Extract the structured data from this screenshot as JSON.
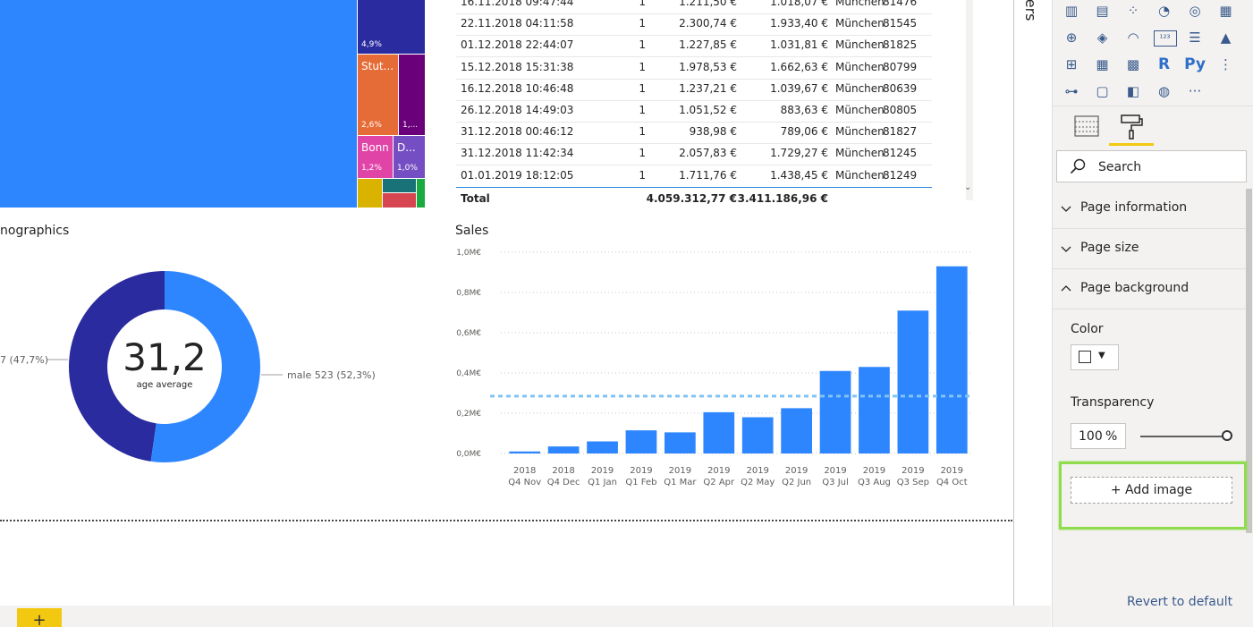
{
  "treemap": {
    "tiles": [
      {
        "label": "",
        "pct": "",
        "color": "#2E86FF"
      },
      {
        "label": "",
        "pct": "4,9%",
        "color": "#2A2B9E"
      },
      {
        "label": "Stut...",
        "pct": "2,6%",
        "color": "#E66C37"
      },
      {
        "label": "",
        "pct": "1,...",
        "color": "#6B007B"
      },
      {
        "label": "Bonn",
        "pct": "1,2%",
        "color": "#E044A7"
      },
      {
        "label": "D...",
        "pct": "1,0%",
        "color": "#744EC2"
      },
      {
        "label": "",
        "pct": "",
        "color": "#D9B300"
      },
      {
        "label": "",
        "pct": "",
        "color": "#197278"
      },
      {
        "label": "",
        "pct": "",
        "color": "#D64550"
      },
      {
        "label": "",
        "pct": "",
        "color": "#1AAB40"
      }
    ]
  },
  "table": {
    "rows": [
      {
        "date": "16.11.2018 09:47:44",
        "qty": "1",
        "gross": "1.211,50 €",
        "net": "1.018,07 €",
        "city": "München",
        "zip": "81476"
      },
      {
        "date": "22.11.2018 04:11:58",
        "qty": "1",
        "gross": "2.300,74 €",
        "net": "1.933,40 €",
        "city": "München",
        "zip": "81545"
      },
      {
        "date": "01.12.2018 22:44:07",
        "qty": "1",
        "gross": "1.227,85 €",
        "net": "1.031,81 €",
        "city": "München",
        "zip": "81825"
      },
      {
        "date": "15.12.2018 15:31:38",
        "qty": "1",
        "gross": "1.978,53 €",
        "net": "1.662,63 €",
        "city": "München",
        "zip": "80799"
      },
      {
        "date": "16.12.2018 10:46:48",
        "qty": "1",
        "gross": "1.237,21 €",
        "net": "1.039,67 €",
        "city": "München",
        "zip": "80639"
      },
      {
        "date": "26.12.2018 14:49:03",
        "qty": "1",
        "gross": "1.051,52 €",
        "net": "883,63 €",
        "city": "München",
        "zip": "80805"
      },
      {
        "date": "31.12.2018 00:46:12",
        "qty": "1",
        "gross": "938,98 €",
        "net": "789,06 €",
        "city": "München",
        "zip": "81827"
      },
      {
        "date": "31.12.2018 11:42:34",
        "qty": "1",
        "gross": "2.057,83 €",
        "net": "1.729,27 €",
        "city": "München",
        "zip": "81245"
      },
      {
        "date": "01.01.2019 18:12:05",
        "qty": "1",
        "gross": "1.711,76 €",
        "net": "1.438,45 €",
        "city": "München",
        "zip": "81249"
      }
    ],
    "total_label": "Total",
    "total_gross": "4.059.312,77 €",
    "total_net": "3.411.186,96 €"
  },
  "demographics": {
    "title": "nographics",
    "center_value": "31,2",
    "center_label": "age average",
    "left_label": "7 (47,7%)",
    "right_label": "male 523 (52,3%)",
    "slices": [
      {
        "value": 47.7,
        "color": "#2A2B9E"
      },
      {
        "value": 52.3,
        "color": "#2E86FF"
      }
    ]
  },
  "chart_data": {
    "type": "bar",
    "title": "Sales",
    "categories": [
      "2018 Q4 Nov",
      "2018 Q4 Dec",
      "2019 Q1 Jan",
      "2019 Q1 Feb",
      "2019 Q1 Mar",
      "2019 Q2 Apr",
      "2019 Q2 May",
      "2019 Q2 Jun",
      "2019 Q3 Jul",
      "2019 Q3 Aug",
      "2019 Q3 Sep",
      "2019 Q4 Oct"
    ],
    "category_lines": [
      [
        "2018",
        "Q4 Nov"
      ],
      [
        "2018",
        "Q4 Dec"
      ],
      [
        "2019",
        "Q1 Jan"
      ],
      [
        "2019",
        "Q1 Feb"
      ],
      [
        "2019",
        "Q1 Mar"
      ],
      [
        "2019",
        "Q2 Apr"
      ],
      [
        "2019",
        "Q2 May"
      ],
      [
        "2019",
        "Q2 Jun"
      ],
      [
        "2019",
        "Q3 Jul"
      ],
      [
        "2019",
        "Q3 Aug"
      ],
      [
        "2019",
        "Q3 Sep"
      ],
      [
        "2019",
        "Q4 Oct"
      ]
    ],
    "values": [
      0.01,
      0.035,
      0.06,
      0.115,
      0.105,
      0.205,
      0.18,
      0.225,
      0.41,
      0.43,
      0.71,
      0.93
    ],
    "average_line": 0.285,
    "ylim": [
      0,
      1.0
    ],
    "yticks": [
      0,
      0.2,
      0.4,
      0.6,
      0.8,
      1.0
    ],
    "ytick_labels": [
      "0,0M€",
      "0,2M€",
      "0,4M€",
      "0,6M€",
      "0,8M€",
      "1,0M€"
    ],
    "bar_color": "#2E86FF",
    "average_color": "#7FC4F2",
    "xlabel": "",
    "ylabel": ""
  },
  "filters": {
    "label": "lters"
  },
  "viz_pane": {
    "icons": [
      [
        "stacked-bar-icon",
        "▥"
      ],
      [
        "clustered-column-icon",
        "▤"
      ],
      [
        "scatter-icon",
        "⁘"
      ],
      [
        "pie-icon",
        "◔"
      ],
      [
        "donut-icon",
        "◎"
      ],
      [
        "treemap-icon",
        "▦"
      ],
      [
        "globe-map-icon",
        "⊕"
      ],
      [
        "filled-map-icon",
        "◈"
      ],
      [
        "gauge-icon",
        "◠"
      ],
      [
        "card-icon",
        "¹²³"
      ],
      [
        "multirow-card-icon",
        "☰"
      ],
      [
        "kpi-icon",
        "▲"
      ],
      [
        "slicer-icon",
        "⊞"
      ],
      [
        "table-icon",
        "▦"
      ],
      [
        "matrix-icon",
        "▩"
      ],
      [
        "r-visual-icon",
        "R"
      ],
      [
        "python-visual-icon",
        "Py"
      ],
      [
        "key-influencers-icon",
        "⋮"
      ],
      [
        "decomposition-tree-icon",
        "⊶"
      ],
      [
        "qa-icon",
        "▢"
      ],
      [
        "custom-visual-icon",
        "◧"
      ],
      [
        "arcgis-icon",
        "◍"
      ],
      [
        "more-visuals-icon",
        "···"
      ]
    ],
    "search_placeholder": "Search",
    "sections": [
      "Page information",
      "Page size",
      "Page background"
    ],
    "color_label": "Color",
    "color_value": "#ffffff",
    "transparency_label": "Transparency",
    "transparency_value": "100",
    "transparency_unit": "%",
    "transparency_level": 1.0,
    "add_image_label": "+ Add image",
    "revert_label": "Revert to default"
  },
  "tabs": {
    "add_page_label": "+"
  }
}
